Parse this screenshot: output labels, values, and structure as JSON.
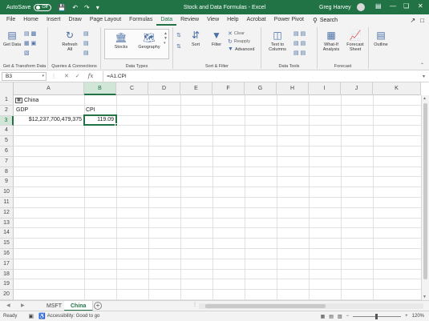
{
  "titlebar": {
    "autosave_label": "AutoSave",
    "autosave_state": "Off",
    "window_title": "Stock and Data Formulas - Excel",
    "user": "Greg Harvey"
  },
  "menu": {
    "tabs": [
      "File",
      "Home",
      "Insert",
      "Draw",
      "Page Layout",
      "Formulas",
      "Data",
      "Review",
      "View",
      "Help",
      "Acrobat",
      "Power Pivot"
    ],
    "active_tab": "Data",
    "search_label": "Search"
  },
  "ribbon": {
    "get_data": "Get Data",
    "refresh_all": "Refresh All",
    "stocks": "Stocks",
    "geography": "Geography",
    "sort": "Sort",
    "filter": "Filter",
    "clear": "Clear",
    "reapply": "Reapply",
    "advanced": "Advanced",
    "text_to_columns": "Text to Columns",
    "what_if": "What-If Analysis",
    "forecast_sheet": "Forecast Sheet",
    "outline": "Outline",
    "groups": {
      "get_transform": "Get & Transform Data",
      "queries": "Queries & Connections",
      "data_types": "Data Types",
      "sort_filter": "Sort & Filter",
      "data_tools": "Data Tools",
      "forecast": "Forecast"
    }
  },
  "formula_bar": {
    "name_box": "B3",
    "fx": "fx",
    "formula": "=A1.CPI"
  },
  "grid": {
    "columns": [
      "A",
      "B",
      "C",
      "D",
      "E",
      "F",
      "G",
      "H",
      "I",
      "J",
      "K"
    ],
    "rows": [
      "1",
      "2",
      "3",
      "4",
      "5",
      "6",
      "7",
      "8",
      "9",
      "10",
      "11",
      "12",
      "13",
      "14",
      "15",
      "16",
      "17",
      "18",
      "19",
      "20"
    ],
    "cells": {
      "A1": "China",
      "A2": "GDP",
      "A3": "$12,237,700,479,375",
      "B2": "CPI",
      "B3": "119.09"
    }
  },
  "sheets": {
    "tabs": [
      "MSFT",
      "China"
    ],
    "active": "China"
  },
  "status": {
    "mode": "Ready",
    "accessibility": "Accessibility: Good to go",
    "zoom": "120%"
  },
  "colors": {
    "accent": "#217346"
  }
}
